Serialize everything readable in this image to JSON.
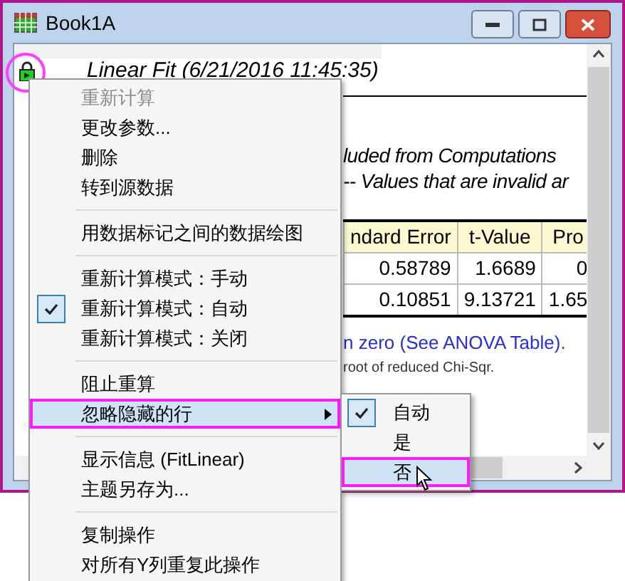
{
  "window": {
    "title": "Book1A"
  },
  "report": {
    "title": "Linear Fit (6/21/2016 11:45:35)",
    "lines": [
      "luded from Computations",
      "-- Values that are invalid ar"
    ],
    "table": {
      "columns": [
        "ndard Error",
        "t-Value",
        "Pro"
      ],
      "rows": [
        [
          "0.58789",
          "1.6689",
          "0"
        ],
        [
          "0.10851",
          "9.13721",
          "1.65"
        ]
      ]
    },
    "notes": [
      {
        "kind": "link",
        "text": "n zero (See ANOVA Table)."
      },
      {
        "kind": "small",
        "text": "root of reduced Chi-Sqr."
      }
    ]
  },
  "context_menu": {
    "items": [
      {
        "kind": "item",
        "label": "重新计算",
        "disabled": true,
        "checked": false,
        "selected": false,
        "submenu": false
      },
      {
        "kind": "item",
        "label": "更改参数...",
        "disabled": false,
        "checked": false,
        "selected": false,
        "submenu": false
      },
      {
        "kind": "item",
        "label": "删除",
        "disabled": false,
        "checked": false,
        "selected": false,
        "submenu": false
      },
      {
        "kind": "item",
        "label": "转到源数据",
        "disabled": false,
        "checked": false,
        "selected": false,
        "submenu": false
      },
      {
        "kind": "separator"
      },
      {
        "kind": "item",
        "label": "用数据标记之间的数据绘图",
        "disabled": false,
        "checked": false,
        "selected": false,
        "submenu": false
      },
      {
        "kind": "separator"
      },
      {
        "kind": "item",
        "label": "重新计算模式：手动",
        "disabled": false,
        "checked": false,
        "selected": false,
        "submenu": false
      },
      {
        "kind": "item",
        "label": "重新计算模式：自动",
        "disabled": false,
        "checked": true,
        "selected": false,
        "submenu": false
      },
      {
        "kind": "item",
        "label": "重新计算模式：关闭",
        "disabled": false,
        "checked": false,
        "selected": false,
        "submenu": false
      },
      {
        "kind": "separator"
      },
      {
        "kind": "item",
        "label": "阻止重算",
        "disabled": false,
        "checked": false,
        "selected": false,
        "submenu": false
      },
      {
        "kind": "item",
        "label": "忽略隐藏的行",
        "disabled": false,
        "checked": false,
        "selected": true,
        "submenu": true
      },
      {
        "kind": "separator"
      },
      {
        "kind": "item",
        "label": "显示信息 (FitLinear)",
        "disabled": false,
        "checked": false,
        "selected": false,
        "submenu": false
      },
      {
        "kind": "item",
        "label": "主题另存为...",
        "disabled": false,
        "checked": false,
        "selected": false,
        "submenu": false
      },
      {
        "kind": "separator"
      },
      {
        "kind": "item",
        "label": "复制操作",
        "disabled": false,
        "checked": false,
        "selected": false,
        "submenu": false
      },
      {
        "kind": "item",
        "label": "对所有Y列重复此操作",
        "disabled": false,
        "checked": false,
        "selected": false,
        "submenu": false
      }
    ]
  },
  "submenu": {
    "items": [
      {
        "label": "自动",
        "checked": true,
        "selected": false
      },
      {
        "label": "是",
        "checked": false,
        "selected": false
      },
      {
        "label": "否",
        "checked": false,
        "selected": true
      }
    ]
  }
}
